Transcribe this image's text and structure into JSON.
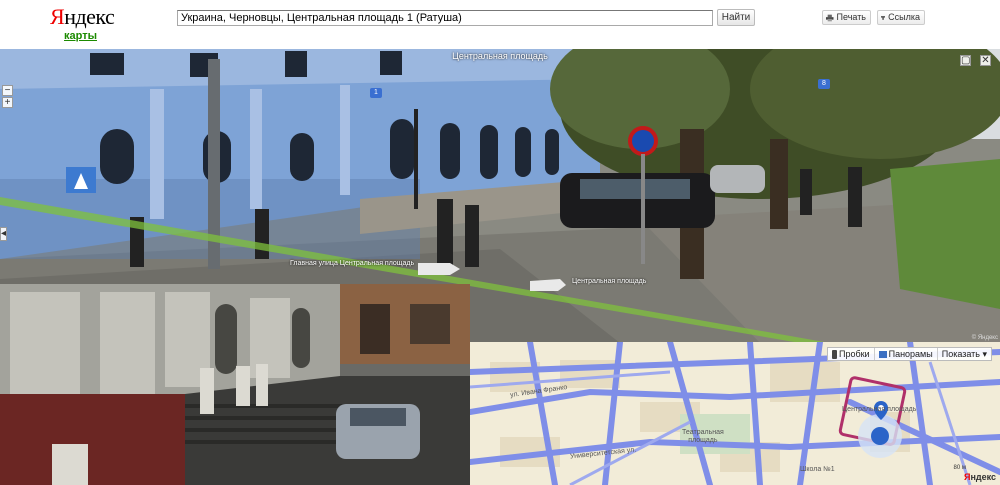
{
  "header": {
    "logo_first": "Я",
    "logo_rest": "ндекс",
    "maps_link": "карты",
    "search_value": "Украина, Черновцы, Центральная площадь 1 (Ратуша)",
    "search_button": "Найти",
    "print_label": "Печать",
    "link_label": "Ссылка"
  },
  "panorama": {
    "street_name": "Центральная площадь",
    "close_glyph": "✕",
    "zoom_in_glyph": "+",
    "zoom_out_glyph": "−",
    "arrow_glyph": "◂",
    "tag_left": "Главная улица  Центральная площадь",
    "tag_right": "Центральная площадь",
    "marker_1": "1",
    "marker_8": "8",
    "copyright": "© Яндекс"
  },
  "map": {
    "traffic_label": "Пробки",
    "panoramas_label": "Панорамы",
    "show_label": "Показать ▾",
    "square_label": "Театральная\nплощадь",
    "street_labels": [
      "ул. Ивана Франко",
      "Центральная площадь",
      "Школа №1",
      "Университетская ул."
    ],
    "scale": "80 м",
    "copyright_first": "Я",
    "copyright_rest": "ндекс"
  },
  "icons": {
    "print": "printer-icon",
    "link": "link-icon",
    "traffic": "traffic-light-icon",
    "panoramas": "panorama-icon",
    "location": "map-pin-icon"
  },
  "colors": {
    "logo_red": "#e00000",
    "maps_green": "#1c8a00",
    "building_blue": "#7ea3d6",
    "road_blue": "#7f8ee8",
    "map_bg": "#f2ecd8",
    "route_purple": "#b0306a"
  }
}
